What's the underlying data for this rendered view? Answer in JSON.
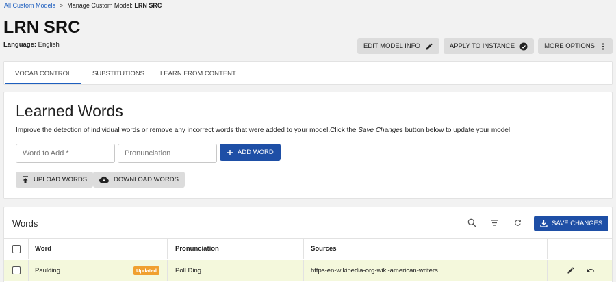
{
  "breadcrumb": {
    "root": "All Custom Models",
    "separator": ">",
    "current_prefix": "Manage Custom Model:",
    "current_name": "LRN SRC"
  },
  "page": {
    "title": "LRN SRC",
    "language_label": "Language:",
    "language_value": "English"
  },
  "actions": {
    "edit": "EDIT MODEL INFO",
    "apply": "APPLY TO INSTANCE",
    "more": "MORE OPTIONS"
  },
  "tabs": [
    "VOCAB CONTROL",
    "SUBSTITUTIONS",
    "LEARN FROM CONTENT"
  ],
  "active_tab": "VOCAB CONTROL",
  "learned": {
    "title": "Learned Words",
    "desc_pre": "Improve the detection of individual words or remove any incorrect words that were added to your model.Click the ",
    "desc_em": "Save Changes",
    "desc_post": " button below to update your model.",
    "word_placeholder": "Word to Add *",
    "pron_placeholder": "Pronunciation",
    "add_word": "ADD WORD",
    "upload": "UPLOAD WORDS",
    "download": "DOWNLOAD WORDS"
  },
  "words": {
    "title": "Words",
    "save": "SAVE CHANGES",
    "columns": {
      "word": "Word",
      "pronunciation": "Pronunciation",
      "sources": "Sources"
    },
    "rows": [
      {
        "word": "Paulding",
        "badge": "Updated",
        "pronunciation": "Poll Ding",
        "sources": "https-en-wikipedia-org-wiki-american-writers"
      }
    ]
  },
  "colors": {
    "accent": "#1e4fa6",
    "link": "#1e5fbf",
    "badge": "#f0a030",
    "updated_row": "#f4f8dc"
  },
  "icons": [
    "pencil-icon",
    "check-circle-icon",
    "more-vert-icon",
    "plus-icon",
    "upload-icon",
    "cloud-download-icon",
    "search-icon",
    "filter-icon",
    "refresh-icon",
    "download-icon",
    "undo-icon"
  ]
}
